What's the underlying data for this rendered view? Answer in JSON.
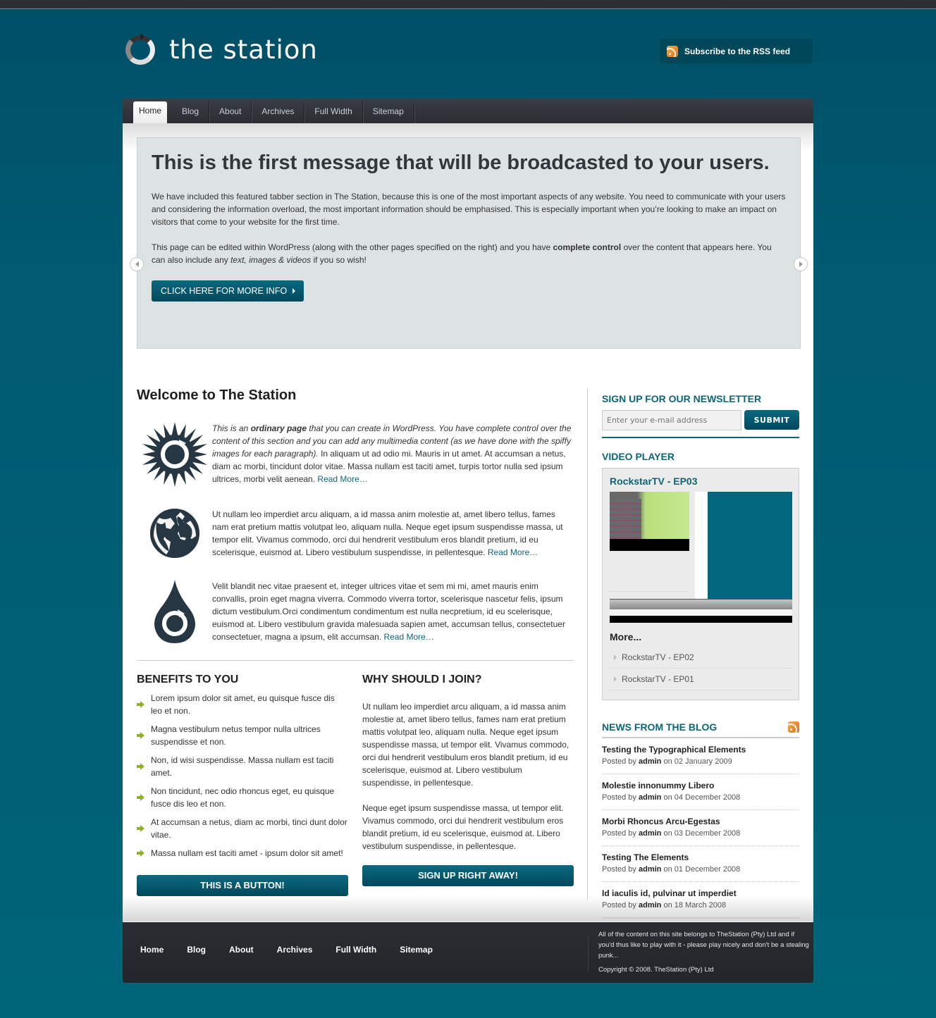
{
  "site": {
    "title": "the station",
    "rss_label": "Subscribe to the RSS feed"
  },
  "nav": {
    "items": [
      {
        "label": "Home",
        "active": true
      },
      {
        "label": "Blog"
      },
      {
        "label": "About"
      },
      {
        "label": "Archives"
      },
      {
        "label": "Full Width"
      },
      {
        "label": "Sitemap"
      }
    ]
  },
  "featured": {
    "heading": "This is the first message that will be broadcasted to your users.",
    "p1": "We have included this featured tabber section in The Station, because this is one of the most important aspects of any website. You need to communicate with your users and considering the information overload, the most important information should be emphasised. This is especially important when you’re looking to make an impact on visitors that come to your website for the first time.",
    "p2_a": "This page can be edited within WordPress (along with the other pages specified on the right) and you have ",
    "p2_bold": "complete control",
    "p2_b": " over the content that appears here. You can also include any ",
    "p2_italic": "text, images & videos",
    "p2_c": " if you so wish!",
    "cta_label": "CLICK HERE FOR MORE INFO"
  },
  "main": {
    "heading": "Welcome to The Station",
    "features": [
      {
        "icon": "sun-cycle-icon",
        "i1": "This is an ",
        "ibold": "ordinary page",
        "i2": " that you can create in WordPress. You have complete control over the content of this section and you can add any multimedia content (as we have done with the spiffy images for each paragraph).",
        "text": " In aliquam ut ad odio mi. Mauris in ut amet. At accumsan a netus, diam ac morbi, tincidunt dolor vitae. Massa nullam est taciti amet, turpis tortor nulla sed ipsum ultrices, morbi velit aenean. ",
        "read_more": "Read More…"
      },
      {
        "icon": "globe-icon",
        "text": "Ut nullam leo imperdiet arcu aliquam, a id massa anim molestie at, amet libero tellus, fames nam erat pretium mattis volutpat leo, aliquam nulla. Neque eget ipsum suspendisse massa, ut tempor elit. Vivamus commodo, orci dui hendrerit vestibulum eros blandit pretium, id eu scelerisque, euismod at. Libero vestibulum suspendisse, in pellentesque. ",
        "read_more": "Read More…"
      },
      {
        "icon": "water-drop-icon",
        "text": "Velit blandit nec vitae praesent et, integer ultrices vitae et sem mi mi, amet mauris enim convallis, proin eget magna viverra. Commodo viverra tortor, scelerisque nascetur felis, ipsum dictum vestibulum.Orci condimentum condimentum est nulla necpretium, id eu scelerisque, euismod at. Libero vestibulum gravida malesuada sapien amet, accumsan tellus, consectetuer consectetuer, magna a ipsum, elit accumsan. ",
        "read_more": "Read More…"
      }
    ],
    "benefits": {
      "heading": "BENEFITS TO YOU",
      "items": [
        "Lorem ipsum dolor sit amet, eu quisque fusce dis leo et non.",
        "Magna vestibulum netus tempor nulla ultrices suspendisse et non.",
        "Non, id wisi suspendisse. Massa nullam est taciti amet.",
        "Non tincidunt, nec odio rhoncus eget, eu quisque fusce dis leo et non.",
        "At accumsan a netus, diam ac morbi, tinci dunt dolor vitae.",
        "Massa nullam est taciti amet - ipsum dolor sit amet!"
      ],
      "button": "THIS IS A BUTTON!"
    },
    "join": {
      "heading": "WHY SHOULD I JOIN?",
      "p1": "Ut nullam leo imperdiet arcu aliquam, a id massa anim molestie at, amet libero tellus, fames nam erat pretium mattis volutpat leo, aliquam nulla. Neque eget ipsum suspendisse massa, ut tempor elit. Vivamus commodo, orci dui hendrerit vestibulum eros blandit pretium, id eu scelerisque, euismod at. Libero vestibulum suspendisse, in pellentesque.",
      "p2": "Neque eget ipsum suspendisse massa, ut tempor elit. Vivamus commodo, orci dui hendrerit vestibulum eros blandit pretium, id eu scelerisque, euismod at. Libero vestibulum suspendisse, in pellentesque.",
      "button": "SIGN UP RIGHT AWAY!"
    }
  },
  "sidebar": {
    "newsletter": {
      "heading": "SIGN UP FOR OUR NEWSLETTER",
      "placeholder": "Enter your e-mail address",
      "submit": "SUBMIT"
    },
    "video": {
      "heading": "VIDEO PLAYER",
      "title": "RockstarTV - EP03",
      "more_heading": "More...",
      "episodes": [
        "RockstarTV - EP02",
        "RockstarTV - EP01"
      ]
    },
    "blog": {
      "heading": "NEWS FROM THE BLOG",
      "posts": [
        {
          "title": "Testing the Typographical Elements",
          "prefix": "Posted by ",
          "author": "admin",
          "date": " on 02 January 2009"
        },
        {
          "title": "Molestie innonummy Libero",
          "prefix": "Posted by ",
          "author": "admin",
          "date": " on 04 December 2008"
        },
        {
          "title": "Morbi Rhoncus Arcu-Egestas",
          "prefix": "Posted by ",
          "author": "admin",
          "date": " on 03 December 2008"
        },
        {
          "title": "Testing The Elements",
          "prefix": "Posted by ",
          "author": "admin",
          "date": " on 01 December 2008"
        },
        {
          "title": "Id iaculis id, pulvinar ut imperdiet",
          "prefix": "Posted by ",
          "author": "admin",
          "date": " on 18 March 2008"
        }
      ]
    }
  },
  "footer": {
    "nav": [
      "Home",
      "Blog",
      "About",
      "Archives",
      "Full Width",
      "Sitemap"
    ],
    "notice": "All of the content on this site belongs to TheStation (Pty) Ltd and if you'd thus like to play with it - please play nicely and don't be a stealing punk...",
    "copyright": "Copyright © 2008. TheStation (Pty) Ltd"
  },
  "colors": {
    "background": "#005a72",
    "accent": "#0d6577",
    "nav_bg": "#2a2d32",
    "featured_bg": "#dde2e3",
    "bullet_green": "#8fb02c",
    "rss_orange": "#e3701a"
  }
}
